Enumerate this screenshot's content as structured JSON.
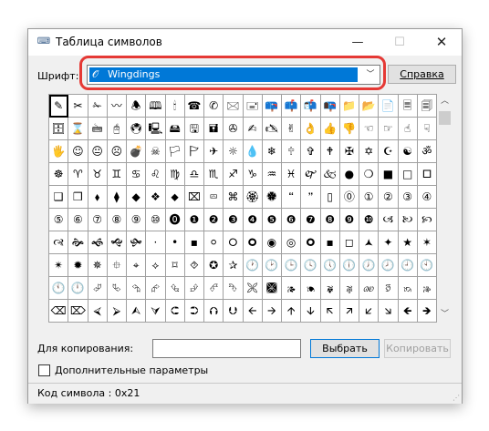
{
  "window": {
    "title": "Таблица символов",
    "icon": "charmap-app-icon",
    "controls": {
      "minimize": "—",
      "maximize": "☐",
      "close": "✕"
    }
  },
  "font": {
    "label": "Шрифт:",
    "selected": "Wingdings",
    "icon": "font-type-icon",
    "help_button": "Справка"
  },
  "grid": {
    "rows": [
      [
        "✎",
        "✂",
        "✁",
        "〰",
        "🕭",
        "🕮",
        "🕯",
        "☎",
        "✆",
        "🖂",
        "🖃",
        "📪",
        "📫",
        "📬",
        "📭",
        "📁",
        "📂",
        "📄",
        "🗏",
        "🗐"
      ],
      [
        "🗄",
        "⌛",
        "🖮",
        "🖰",
        "🖲",
        "🖳",
        "🖴",
        "🖫",
        "🖬",
        "✇",
        "✍",
        "🖎",
        "✌",
        "👌",
        "👍",
        "👎",
        "☜",
        "☞",
        "☝",
        "☟"
      ],
      [
        "🖐",
        "☺",
        "😐",
        "☹",
        "💣",
        "☠",
        "🏳",
        "🏱",
        "✈",
        "☼",
        "💧",
        "❄",
        "🕆",
        "✞",
        "🕈",
        "✠",
        "✡",
        "☪",
        "☯",
        "ॐ"
      ],
      [
        "☸",
        "♈",
        "♉",
        "♊",
        "♋",
        "♌",
        "♍",
        "♎",
        "♏",
        "♐",
        "♑",
        "♒",
        "♓",
        "🙰",
        "🙵",
        "●",
        "❍",
        "■",
        "□",
        "🞐"
      ],
      [
        "❑",
        "❒",
        "⬧",
        "⧫",
        "◆",
        "❖",
        "⬥",
        "⌧",
        "⮹",
        "⌘",
        "🏵",
        "🏶",
        "🙶",
        "🙷",
        "▯",
        "⓪",
        "①",
        "②",
        "③",
        "④"
      ],
      [
        "⑤",
        "⑥",
        "⑦",
        "⑧",
        "⑨",
        "⑩",
        "⓿",
        "❶",
        "❷",
        "❸",
        "❹",
        "❺",
        "❻",
        "❼",
        "❽",
        "❾",
        "❿",
        "🙢",
        "🙠",
        "🙡"
      ],
      [
        "🙣",
        "🙞",
        "🙜",
        "🙝",
        "🙟",
        "·",
        "•",
        "▪",
        "⚪",
        "🞆",
        "🞈",
        "◉",
        "◎",
        "🞉",
        "▪",
        "◻",
        "🟂",
        "✦",
        "★",
        "✶"
      ],
      [
        "✴",
        "✹",
        "✵",
        "⯐",
        "⌖",
        "⟡",
        "⌑",
        "⯑",
        "✪",
        "✰",
        "🕐",
        "🕑",
        "🕒",
        "🕓",
        "🕔",
        "🕕",
        "🕖",
        "🕗",
        "🕘",
        "🕙"
      ],
      [
        "🕚",
        "🕛",
        "⮰",
        "⮱",
        "⮲",
        "⮳",
        "⮴",
        "⮵",
        "⮶",
        "⮷",
        "🙪",
        "🙫",
        "🙕",
        "🙔",
        "🙗",
        "🙖",
        "🙐",
        "🙑",
        "🙒",
        "🙓"
      ],
      [
        "⌫",
        "⌦",
        "⮘",
        "⮚",
        "⮙",
        "⮛",
        "⮈",
        "⮊",
        "⮉",
        "⮋",
        "🡨",
        "🡪",
        "🡩",
        "🡫",
        "🡬",
        "🡭",
        "🡯",
        "🡮",
        "🡸",
        "🡺"
      ]
    ]
  },
  "copy": {
    "label": "Для копирования:",
    "value": "",
    "select_button": "Выбрать",
    "copy_button": "Копировать"
  },
  "advanced": {
    "label": "Дополнительные параметры"
  },
  "status": {
    "text": "Код символа : 0x21"
  },
  "colors": {
    "selection": "#0078d7",
    "highlight_ring": "#e53935"
  }
}
